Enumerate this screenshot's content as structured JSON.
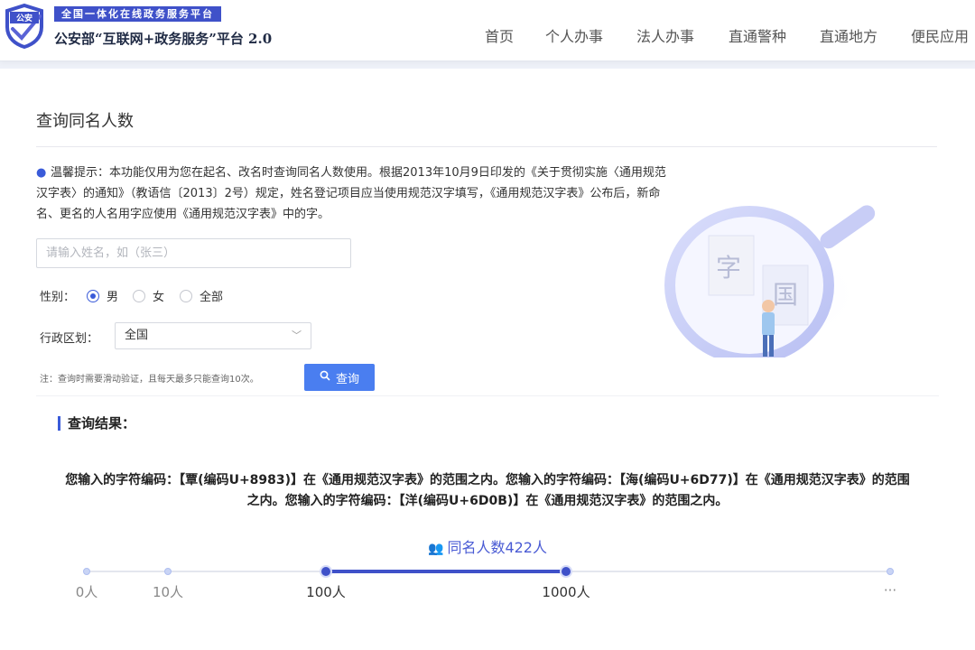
{
  "header": {
    "logo_shield_text": "公安",
    "platform_tag": "全国一体化在线政务服务平台",
    "platform_title": "公安部“互联网+政务服务”平台 2.0",
    "nav": [
      "首页",
      "个人办事",
      "法人办事",
      "直通警种",
      "直通地方",
      "便民应用"
    ]
  },
  "page": {
    "title": "查询同名人数",
    "tip_label": "温馨提示：",
    "tip_text": "本功能仅用为您在起名、改名时查询同名人数使用。根据2013年10月9日印发的《关于贯彻实施〈通用规范汉字表〉的通知》（教语信〔2013〕2号）规定，姓名登记项目应当使用规范汉字填写，《通用规范汉字表》公布后，新命名、更名的人名用字应使用《通用规范汉字表》中的字。"
  },
  "form": {
    "name_input": {
      "value": "",
      "placeholder": "请输入姓名，如（张三）"
    },
    "gender_label": "性别：",
    "gender_options": [
      "男",
      "女",
      "全部"
    ],
    "gender_selected": "男",
    "region_label": "行政区划：",
    "region_value": "全国",
    "note": "注：查询时需要滑动验证，且每天最多只能查询10次。",
    "search_button": "查询"
  },
  "illustration": {
    "char_1": "字",
    "char_2": "国"
  },
  "result": {
    "title": "查询结果：",
    "text": "您输入的字符编码：【覃(编码U+8983)】在《通用规范汉字表》的范围之内。您输入的字符编码：【海(编码U+6D77)】在《通用规范汉字表》的范围之内。您输入的字符编码：【洋(编码U+6D0B)】在《通用规范汉字表》的范围之内。",
    "count_text": "同名人数422人",
    "count_value": 422,
    "scale_labels": [
      "0人",
      "10人",
      "100人",
      "1000人",
      "···"
    ]
  },
  "colors": {
    "accent": "#3f51c9",
    "button": "#4a7ef0"
  }
}
